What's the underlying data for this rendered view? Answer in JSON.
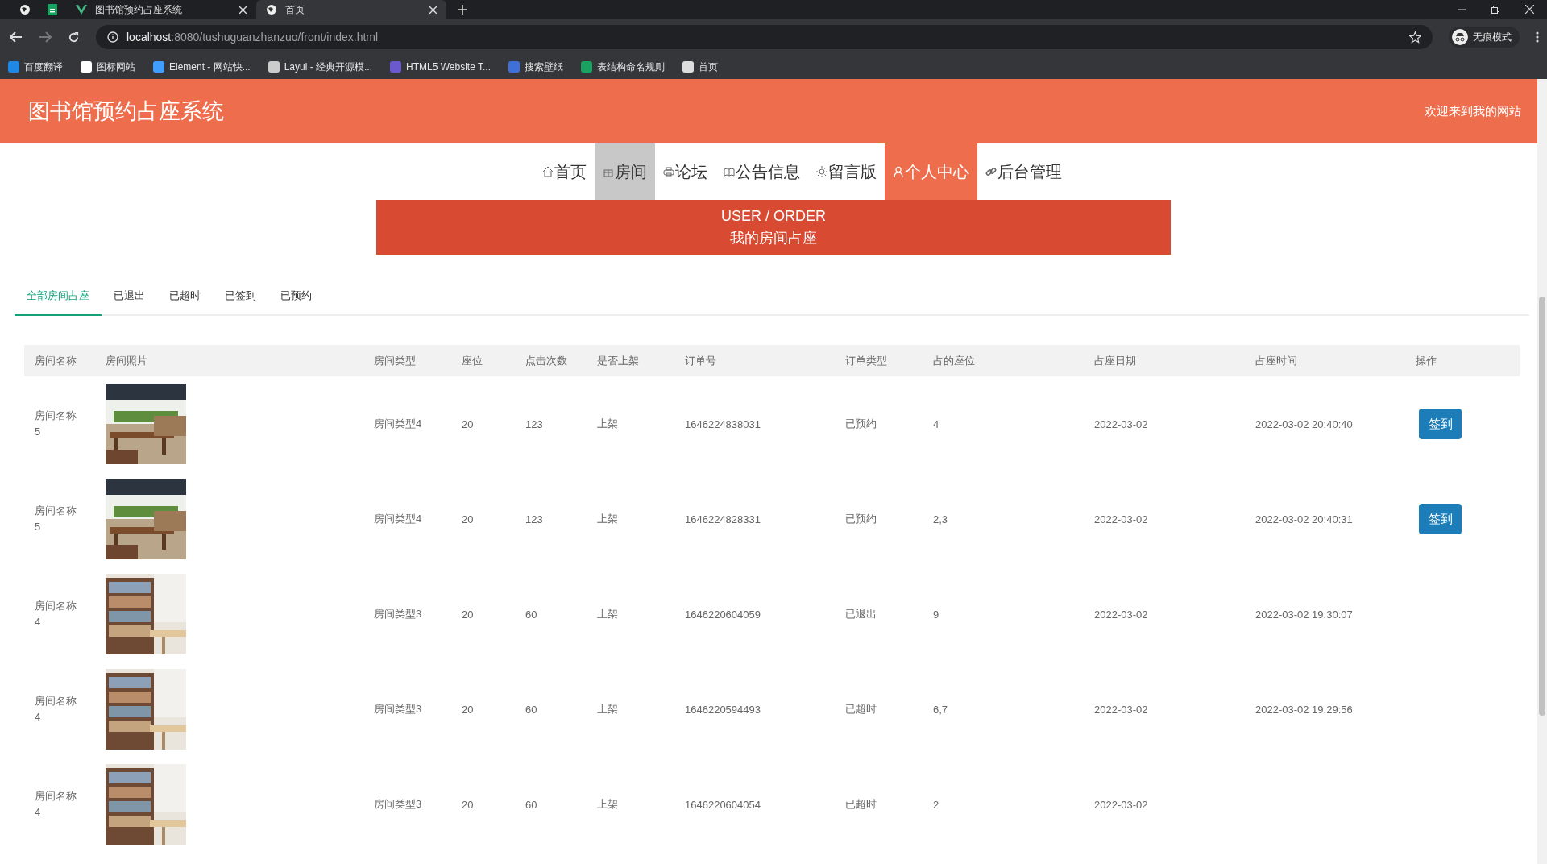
{
  "browser": {
    "tabs": [
      {
        "kind": "pinned",
        "selected": false
      },
      {
        "kind": "pinned-sheet",
        "selected": false
      },
      {
        "kind": "vue",
        "title": "图书馆预约占座系统",
        "selected": false
      },
      {
        "kind": "globe",
        "title": "首页",
        "selected": true
      }
    ],
    "url_host": "localhost",
    "url_rest": ":8080/tushuguanzhanzuo/front/index.html",
    "profile": "无痕模式",
    "bookmarks": [
      {
        "label": "百度翻译",
        "color": "#1e88e5"
      },
      {
        "label": "图标网站",
        "color": "#ffffff"
      },
      {
        "label": "Element - 网站快...",
        "color": "#409eff"
      },
      {
        "label": "Layui - 经典开源模...",
        "color": "#cccccc"
      },
      {
        "label": "HTML5 Website T...",
        "color": "#6a5acd"
      },
      {
        "label": "搜索壁纸",
        "color": "#3f6fd8"
      },
      {
        "label": "表结构命名规则",
        "color": "#1aa260"
      },
      {
        "label": "首页",
        "color": "#dddddd"
      }
    ]
  },
  "header": {
    "title": "图书馆预约占座系统",
    "welcome": "欢迎来到我的网站"
  },
  "nav": [
    {
      "label": "首页",
      "selected": false,
      "hover": false
    },
    {
      "label": "房间",
      "selected": false,
      "hover": true
    },
    {
      "label": "论坛",
      "selected": false,
      "hover": false
    },
    {
      "label": "公告信息",
      "selected": false,
      "hover": false
    },
    {
      "label": "留言版",
      "selected": false,
      "hover": false
    },
    {
      "label": "个人中心",
      "selected": true,
      "hover": false
    },
    {
      "label": "后台管理",
      "selected": false,
      "hover": false
    }
  ],
  "banner": {
    "title": "USER / ORDER",
    "subtitle": "我的房间占座"
  },
  "filter_tabs": [
    {
      "label": "全部房间占座",
      "selected": true
    },
    {
      "label": "已退出",
      "selected": false
    },
    {
      "label": "已超时",
      "selected": false
    },
    {
      "label": "已签到",
      "selected": false
    },
    {
      "label": "已预约",
      "selected": false
    }
  ],
  "table": {
    "columns": [
      "房间名称",
      "房间照片",
      "房间类型",
      "座位",
      "点击次数",
      "是否上架",
      "订单号",
      "订单类型",
      "占的座位",
      "占座日期",
      "占座时间",
      "操作"
    ],
    "rows": [
      {
        "name": "房间名称5",
        "type": "房间类型4",
        "seats": "20",
        "clicks": "123",
        "listed": "上架",
        "order_no": "1646224838031",
        "order_type": "已预约",
        "seat": "4",
        "date": "2022-03-02",
        "time": "2022-03-02 20:40:40",
        "action": "签到"
      },
      {
        "name": "房间名称5",
        "type": "房间类型4",
        "seats": "20",
        "clicks": "123",
        "listed": "上架",
        "order_no": "1646224828331",
        "order_type": "已预约",
        "seat": "2,3",
        "date": "2022-03-02",
        "time": "2022-03-02 20:40:31",
        "action": "签到"
      },
      {
        "name": "房间名称4",
        "type": "房间类型3",
        "seats": "20",
        "clicks": "60",
        "listed": "上架",
        "order_no": "1646220604059",
        "order_type": "已退出",
        "seat": "9",
        "date": "2022-03-02",
        "time": "2022-03-02 19:30:07"
      },
      {
        "name": "房间名称4",
        "type": "房间类型3",
        "seats": "20",
        "clicks": "60",
        "listed": "上架",
        "order_no": "1646220594493",
        "order_type": "已超时",
        "seat": "6,7",
        "date": "2022-03-02",
        "time": "2022-03-02 19:29:56"
      },
      {
        "name": "房间名称4",
        "type": "房间类型3",
        "seats": "20",
        "clicks": "60",
        "listed": "上架",
        "order_no": "1646220604054",
        "order_type": "已超时",
        "seat": "2",
        "date": "2022-03-02"
      }
    ]
  }
}
